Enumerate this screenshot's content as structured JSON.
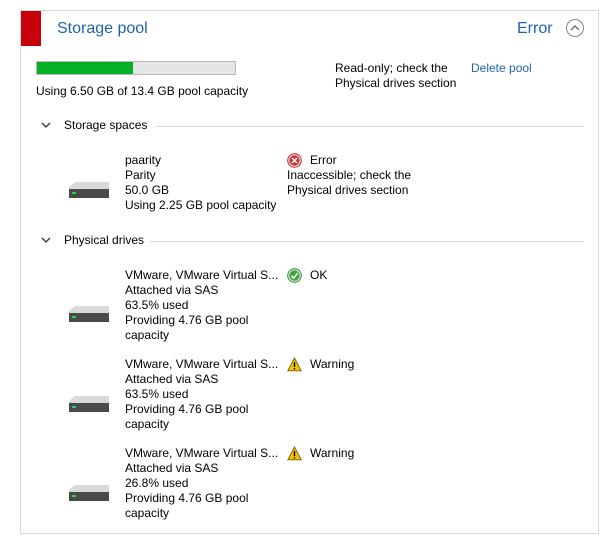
{
  "pool": {
    "title": "Storage pool",
    "status": "Error",
    "usage_fraction": 0.485,
    "usage_text": "Using 6.50 GB of 13.4 GB pool capacity",
    "message_line1": "Read-only; check the",
    "message_line2": "Physical drives section",
    "delete_label": "Delete pool",
    "accent_color": "#c8000a",
    "bar_color": "#06b025"
  },
  "storage_spaces": {
    "heading": "Storage spaces",
    "items": [
      {
        "name": "paarity",
        "type": "Parity",
        "size": "50.0 GB",
        "usage": "Using 2.25 GB pool capacity",
        "status": "Error",
        "status_icon": "error-icon",
        "status_line2": "Inaccessible; check the",
        "status_line3": "Physical drives section"
      }
    ]
  },
  "physical_drives": {
    "heading": "Physical drives",
    "items": [
      {
        "name": "VMware, VMware Virtual S...",
        "connection": "Attached via SAS",
        "used": "63.5% used",
        "providing1": "Providing 4.76 GB pool",
        "providing2": "capacity",
        "status": "OK",
        "status_icon": "ok-icon"
      },
      {
        "name": "VMware, VMware Virtual S...",
        "connection": "Attached via SAS",
        "used": "63.5% used",
        "providing1": "Providing 4.76 GB pool",
        "providing2": "capacity",
        "status": "Warning",
        "status_icon": "warning-icon"
      },
      {
        "name": "VMware, VMware Virtual S...",
        "connection": "Attached via SAS",
        "used": "26.8% used",
        "providing1": "Providing 4.76 GB pool",
        "providing2": "capacity",
        "status": "Warning",
        "status_icon": "warning-icon"
      }
    ]
  }
}
